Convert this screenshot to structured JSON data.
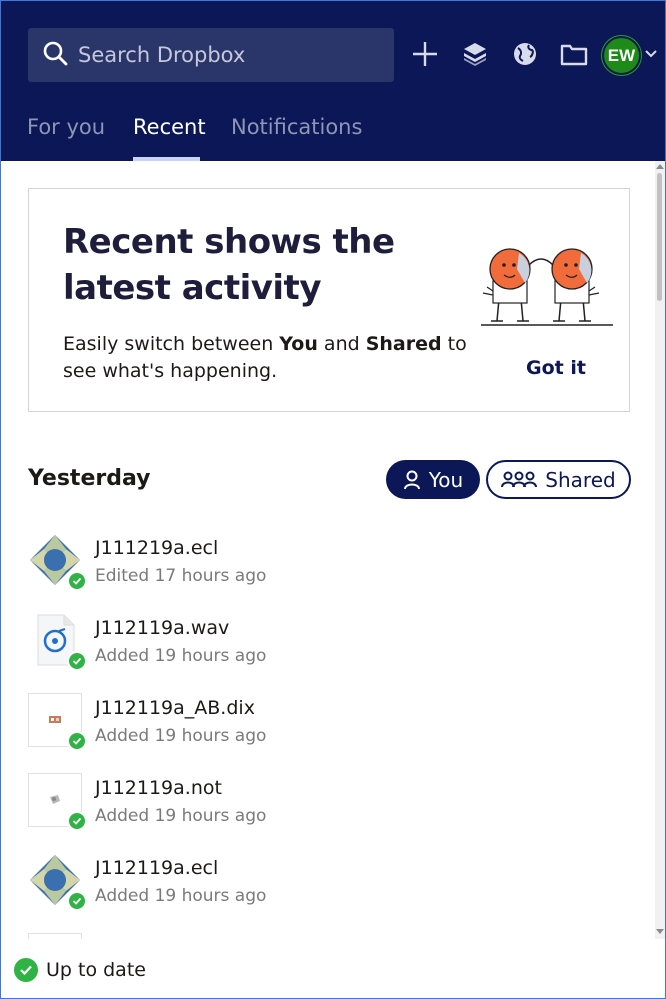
{
  "header": {
    "search_placeholder": "Search Dropbox",
    "avatar_initials": "EW",
    "tabs": [
      {
        "label": "For you",
        "active": false
      },
      {
        "label": "Recent",
        "active": true
      },
      {
        "label": "Notifications",
        "active": false
      }
    ]
  },
  "banner": {
    "title": "Recent shows the latest activity",
    "body_prefix": "Easily switch between ",
    "body_you": "You",
    "body_and": " and ",
    "body_shared": "Shared",
    "body_suffix": " to see what's happening.",
    "action_label": "Got it"
  },
  "section": {
    "title": "Yesterday",
    "filter_you": "You",
    "filter_shared": "Shared"
  },
  "files": [
    {
      "name": "J111219a.ecl",
      "meta": "Edited 17 hours ago",
      "icon": "ecl-diamond-icon"
    },
    {
      "name": "J112119a.wav",
      "meta": "Added 19 hours ago",
      "icon": "audio-file-icon"
    },
    {
      "name": "J112119a_AB.dix",
      "meta": "Added 19 hours ago",
      "icon": "dix-file-icon"
    },
    {
      "name": "J112119a.not",
      "meta": "Added 19 hours ago",
      "icon": "not-file-icon"
    },
    {
      "name": "J112119a.ecl",
      "meta": "Added 19 hours ago",
      "icon": "ecl-diamond-icon"
    }
  ],
  "footer": {
    "status": "Up to date"
  },
  "colors": {
    "header_bg": "#0b1756",
    "accent_green": "#2fb344",
    "avatar_green": "#1e8a18"
  }
}
